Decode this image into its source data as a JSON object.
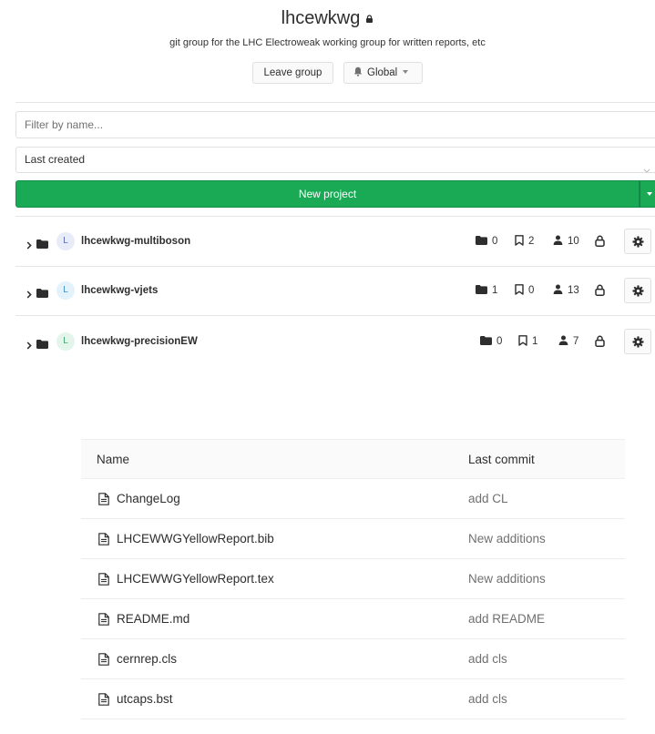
{
  "group": {
    "title": "lhcewkwg",
    "description": "git group for the LHC Electroweak working group for written reports, etc",
    "leave_label": "Leave group",
    "notification_label": "Global",
    "lock_icon": "lock-icon",
    "bell_icon": "bell-icon"
  },
  "filter": {
    "placeholder": "Filter by name...",
    "value": ""
  },
  "sort": {
    "selected": "Last created"
  },
  "new_project": {
    "label": "New project",
    "color": "#1aaa55"
  },
  "subgroups": [
    {
      "avatar": "L",
      "name": "lhcewkwg-multiboson",
      "subgroups": "0",
      "projects": "2",
      "members": "10"
    },
    {
      "avatar": "L",
      "name": "lhcewkwg-vjets",
      "subgroups": "1",
      "projects": "0",
      "members": "13"
    },
    {
      "avatar": "L",
      "name": "lhcewkwg-precisionEW",
      "subgroups": "0",
      "projects": "1",
      "members": "7"
    }
  ],
  "files": {
    "columns": {
      "name": "Name",
      "last_commit": "Last commit"
    },
    "rows": [
      {
        "name": "ChangeLog",
        "commit": "add CL"
      },
      {
        "name": "LHCEWWGYellowReport.bib",
        "commit": "New additions"
      },
      {
        "name": "LHCEWWGYellowReport.tex",
        "commit": "New additions"
      },
      {
        "name": "README.md",
        "commit": "add README"
      },
      {
        "name": "cernrep.cls",
        "commit": "add cls"
      },
      {
        "name": "utcaps.bst",
        "commit": "add cls"
      }
    ]
  }
}
